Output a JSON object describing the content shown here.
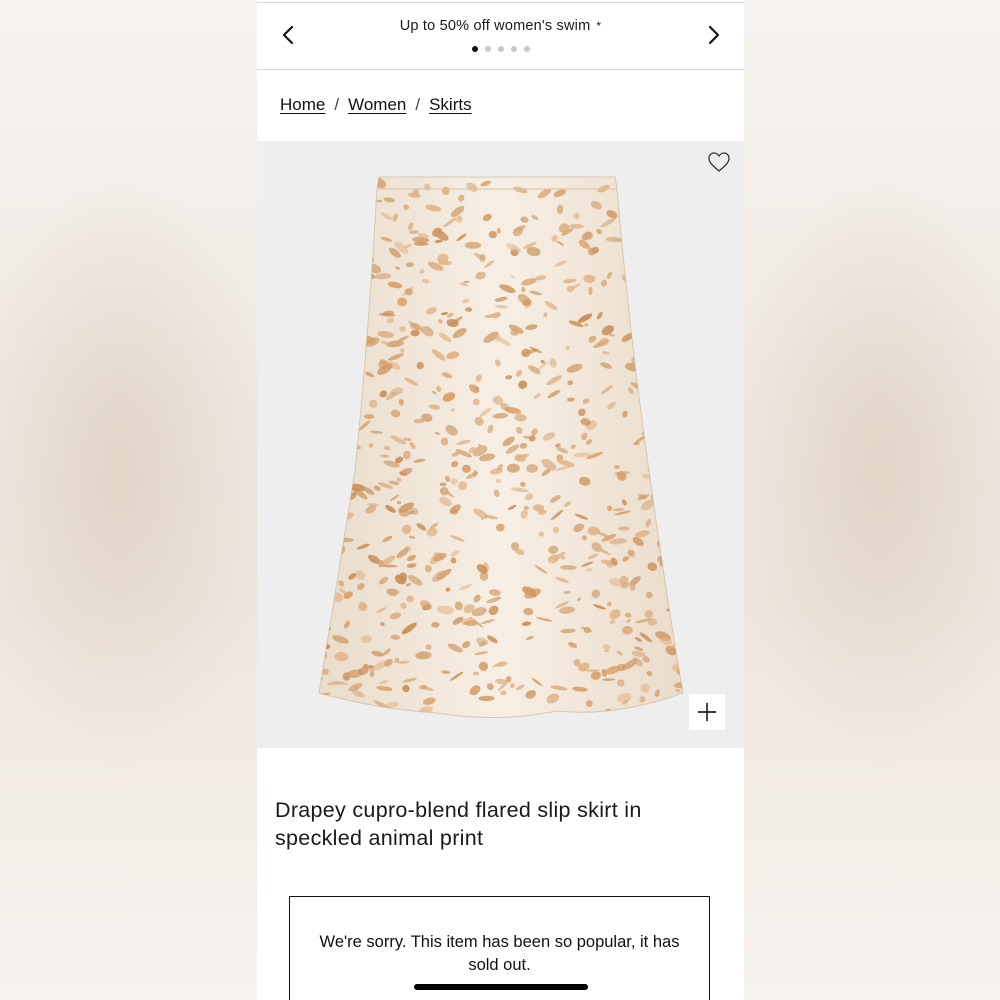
{
  "promo": {
    "text": "Up to 50% off women's swim",
    "star": "*",
    "slide_count": 5,
    "active_slide": 1,
    "prev_icon": "chevron-left-icon",
    "next_icon": "chevron-right-icon"
  },
  "breadcrumb": {
    "items": [
      "Home",
      "Women",
      "Skirts"
    ],
    "separator": "/"
  },
  "product": {
    "title": "Drapey cupro-blend flared slip skirt in speckled animal print",
    "wishlist_icon": "heart-outline-icon",
    "zoom_icon": "plus-icon",
    "image_bg_color": "#eeeeef"
  },
  "availability": {
    "message": "We're sorry. This item has been so popular, it has sold out."
  }
}
